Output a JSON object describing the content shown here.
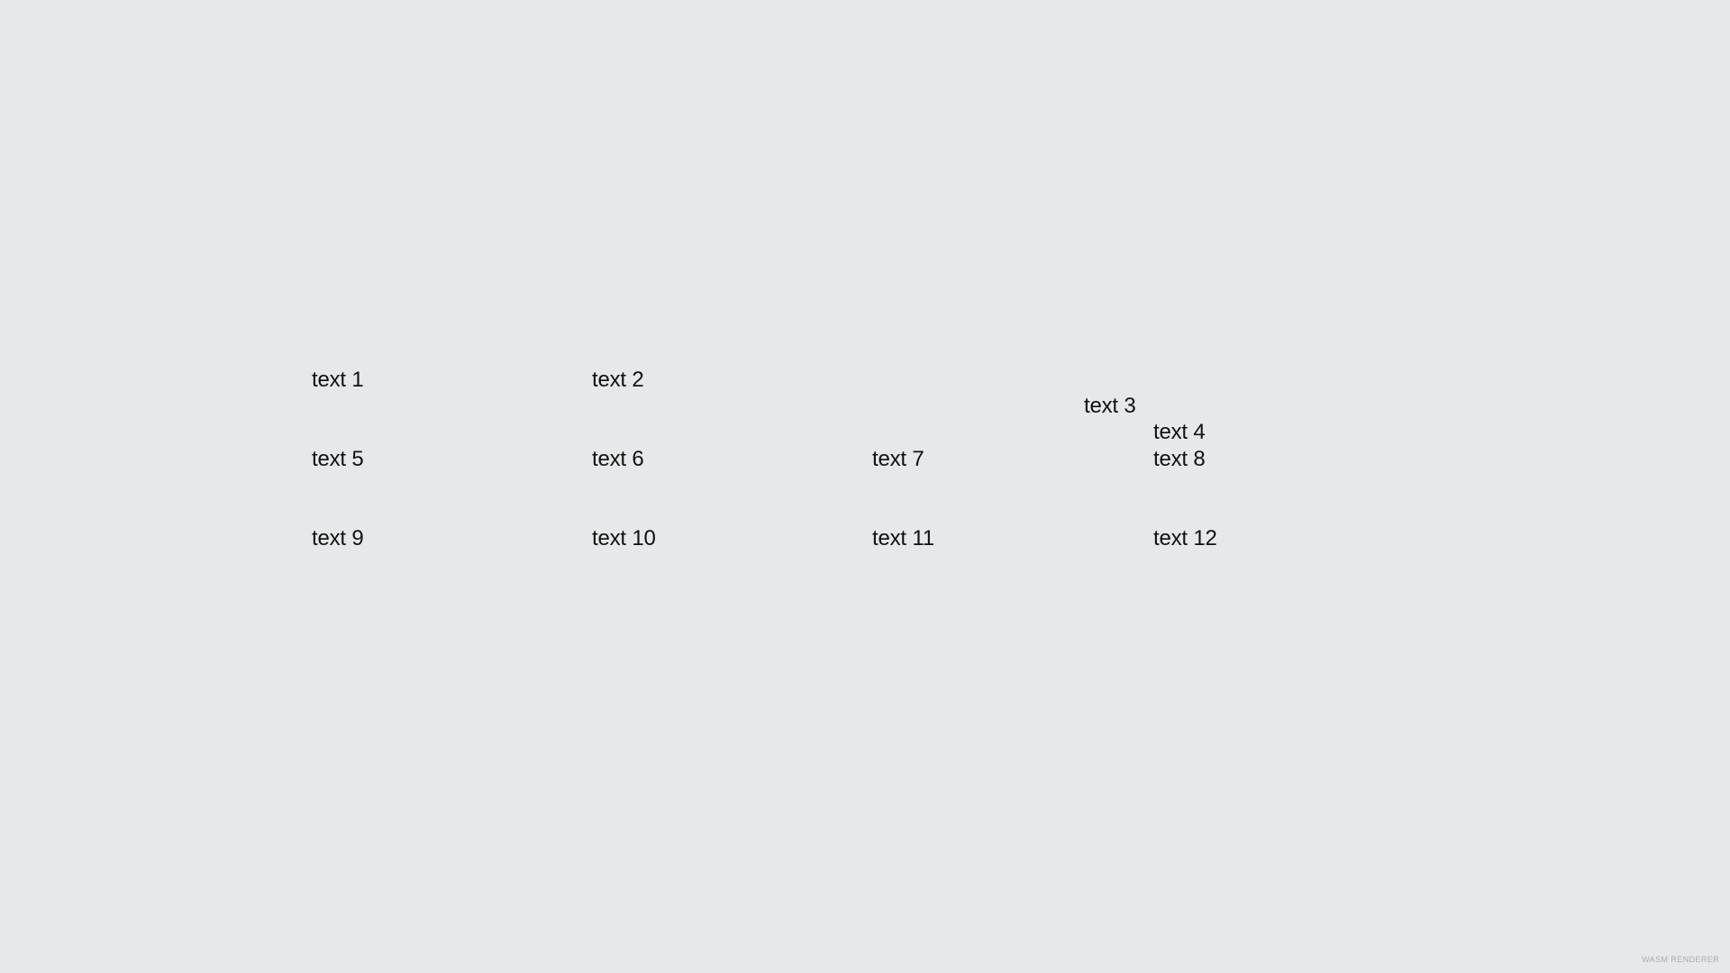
{
  "texts": [
    "text 1",
    "text 2",
    "text 3",
    "text 4",
    "text 5",
    "text 6",
    "text 7",
    "text 8",
    "text 9",
    "text 10",
    "text 11",
    "text 12"
  ],
  "watermark": "WASM RENDERER",
  "colors": {
    "background": "#e7e8ea",
    "text": "#111111",
    "watermark": "#a8aaad"
  }
}
